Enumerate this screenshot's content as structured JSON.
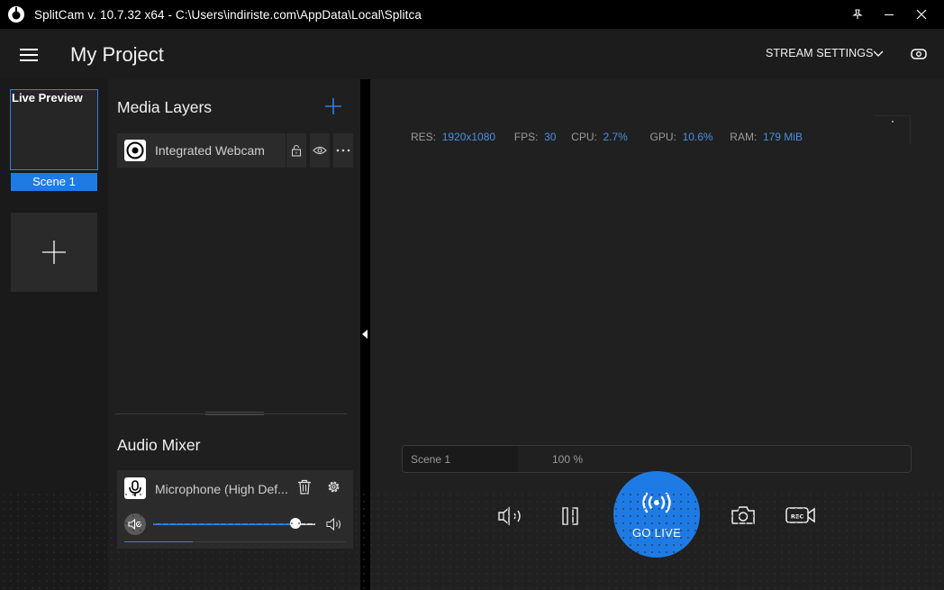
{
  "window": {
    "title": "SplitCam v. 10.7.32 x64 - C:\\Users\\indiriste.com\\AppData\\Local\\Splitca"
  },
  "header": {
    "project_title": "My Project",
    "stream_settings_label": "STREAM SETTINGS"
  },
  "scenes": {
    "preview_label": "Live Preview",
    "items": [
      {
        "label": "Scene 1"
      }
    ]
  },
  "media_layers": {
    "title": "Media Layers",
    "items": [
      {
        "name": "Integrated Webcam"
      }
    ]
  },
  "audio_mixer": {
    "title": "Audio Mixer",
    "device_name": "Microphone (High Def...",
    "volume_level": 0.88,
    "meter_level": 0.31
  },
  "stats": {
    "res_label": "RES:",
    "res_value": "1920x1080",
    "fps_label": "FPS:",
    "fps_value": "30",
    "cpu_label": "CPU:",
    "cpu_value": "2.7%",
    "gpu_label": "GPU:",
    "gpu_value": "10.6%",
    "ram_label": "RAM:",
    "ram_value": "179 MiB"
  },
  "scene_bar": {
    "scene_name": "Scene 1",
    "zoom": "100 %"
  },
  "controls": {
    "go_live_label": "GO LIVE"
  },
  "colors": {
    "accent": "#1e7be6",
    "stat_value": "#4a8fe0"
  }
}
